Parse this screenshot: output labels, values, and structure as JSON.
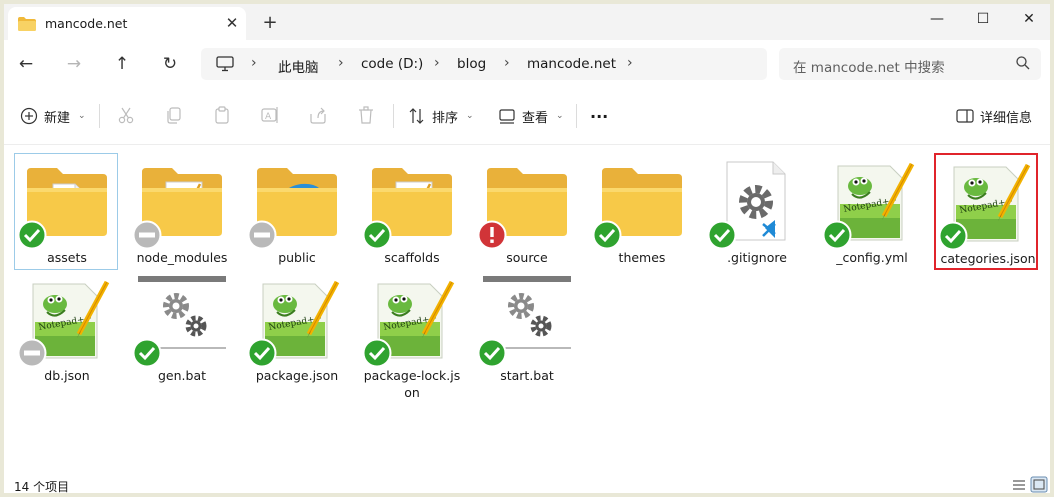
{
  "window": {
    "tab_title": "mancode.net",
    "tab_close": "✕",
    "new_tab": "+",
    "minimize": "—",
    "maximize": "☐",
    "close": "✕"
  },
  "nav": {
    "back": "←",
    "forward": "→",
    "up": "↑",
    "refresh": "↻"
  },
  "breadcrumb": [
    "此电脑",
    "code (D:)",
    "blog",
    "mancode.net"
  ],
  "search": {
    "placeholder": "在 mancode.net 中搜索"
  },
  "toolbar": {
    "new_label": "新建",
    "sort_label": "排序",
    "view_label": "查看",
    "more_label": "···",
    "details_label": "详细信息"
  },
  "files": [
    {
      "name": "assets",
      "type": "folder-doc",
      "status": "ok"
    },
    {
      "name": "node_modules",
      "type": "folder-npp",
      "status": "gray"
    },
    {
      "name": "public",
      "type": "folder-edge",
      "status": "gray"
    },
    {
      "name": "scaffolds",
      "type": "folder-npp",
      "status": "ok"
    },
    {
      "name": "source",
      "type": "folder",
      "status": "error"
    },
    {
      "name": "themes",
      "type": "folder",
      "status": "ok"
    },
    {
      "name": ".gitignore",
      "type": "vscode",
      "status": "ok"
    },
    {
      "name": "_config.yml",
      "type": "npp",
      "status": "ok"
    },
    {
      "name": "categories.json",
      "type": "npp",
      "status": "ok"
    },
    {
      "name": "db.json",
      "type": "npp",
      "status": "gray"
    },
    {
      "name": "gen.bat",
      "type": "bat",
      "status": "ok"
    },
    {
      "name": "package.json",
      "type": "npp",
      "status": "ok"
    },
    {
      "name": "package-lock.json",
      "type": "npp",
      "status": "ok"
    },
    {
      "name": "start.bat",
      "type": "bat",
      "status": "ok"
    }
  ],
  "status": {
    "count": "14 个项目"
  },
  "colors": {
    "folder": "#f7c948",
    "folder_dark": "#e9b13a",
    "ok_green": "#2fa32f",
    "error_red": "#d13438",
    "gray_badge": "#b9b9b9",
    "selection_border": "#9ccbe8",
    "highlight_red": "#e0242b"
  }
}
